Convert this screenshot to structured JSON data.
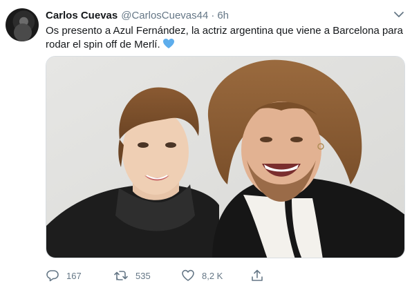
{
  "tweet": {
    "author_name": "Carlos Cuevas",
    "author_handle": "@CarlosCuevas44",
    "separator": "·",
    "time": "6h",
    "text": "Os presento a Azul Fernández, la actriz argentina que viene a Barcelona para rodar el spin off de Merlí.",
    "emoji": "blue-heart"
  },
  "actions": {
    "reply_count": "167",
    "retweet_count": "535",
    "like_count": "8,2 K"
  },
  "colors": {
    "text_primary": "#14171a",
    "text_secondary": "#657786",
    "accent_blue": "#5dadec"
  },
  "icons": [
    "caret-down-icon",
    "reply-icon",
    "retweet-icon",
    "like-icon",
    "share-icon"
  ]
}
